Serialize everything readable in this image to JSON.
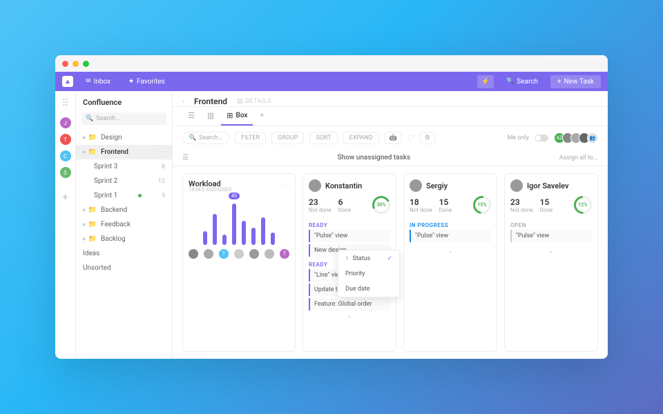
{
  "topbar": {
    "inbox": "Inbox",
    "favorites": "Favorites",
    "search": "Search",
    "new_task": "New Task"
  },
  "rail": {
    "spaces": [
      {
        "letter": "J",
        "color": "#BA68C8"
      },
      {
        "letter": "T",
        "color": "#EF5350"
      },
      {
        "letter": "C",
        "color": "#4FC3F7"
      },
      {
        "letter": "S",
        "color": "#66BB6A"
      }
    ]
  },
  "sidebar": {
    "title": "Confluence",
    "search_placeholder": "Search...",
    "items": [
      {
        "label": "Design",
        "type": "folder"
      },
      {
        "label": "Frontend",
        "type": "folder",
        "active": true,
        "ellipsis": true
      },
      {
        "label": "Sprint 3",
        "type": "list",
        "indent": true,
        "count": "8"
      },
      {
        "label": "Sprint 2",
        "type": "list",
        "indent": true,
        "count": "12"
      },
      {
        "label": "Sprint 1",
        "type": "list",
        "indent": true,
        "dot": true,
        "count": "9"
      },
      {
        "label": "Backend",
        "type": "folder"
      },
      {
        "label": "Feedback",
        "type": "folder"
      },
      {
        "label": "Backlog",
        "type": "folder"
      }
    ],
    "plain": [
      "Ideas",
      "Unsorted"
    ]
  },
  "header": {
    "title": "Frontend",
    "details": "DETAILS"
  },
  "viewtabs": {
    "box": "Box"
  },
  "toolbar": {
    "search": "Search...",
    "filter": "FILTER",
    "group": "GROUP",
    "sort": "SORT",
    "expand": "EXPAND",
    "me_only": "Me only"
  },
  "subbar": {
    "center": "Show unassigned tasks",
    "right": "Assign all to..."
  },
  "workload": {
    "title": "Workload",
    "subtitle": "TASKS ASSIGNED",
    "bubble": "43",
    "bars": [
      20,
      45,
      15,
      60,
      35,
      25,
      40,
      18
    ]
  },
  "people": [
    {
      "name": "Konstantin",
      "not_done": "23",
      "not_done_label": "Not done",
      "done": "6",
      "done_label": "Done",
      "percent": "30%",
      "sections": [
        {
          "label": "READY",
          "type": "ready",
          "tasks": [
            "\"Pulse\" view",
            "New design"
          ]
        },
        {
          "label": "READY",
          "type": "ready",
          "tasks": [
            "\"Line\" view",
            "Update to favorites UX",
            "Feature: Global order"
          ]
        }
      ]
    },
    {
      "name": "Sergiy",
      "not_done": "18",
      "not_done_label": "Not done",
      "done": "15",
      "done_label": "Done",
      "percent": "15%",
      "sections": [
        {
          "label": "IN PROGRESS",
          "type": "progress",
          "tasks": [
            "\"Pulse\" view"
          ]
        }
      ]
    },
    {
      "name": "Igor Savelev",
      "not_done": "23",
      "not_done_label": "Not done",
      "done": "15",
      "done_label": "Done",
      "percent": "12%",
      "sections": [
        {
          "label": "OPEN",
          "type": "open",
          "tasks": [
            "\"Pulse\" view"
          ]
        }
      ]
    }
  ],
  "dropdown": {
    "items": [
      "Status",
      "Priority",
      "Due date"
    ],
    "selected": 0
  }
}
